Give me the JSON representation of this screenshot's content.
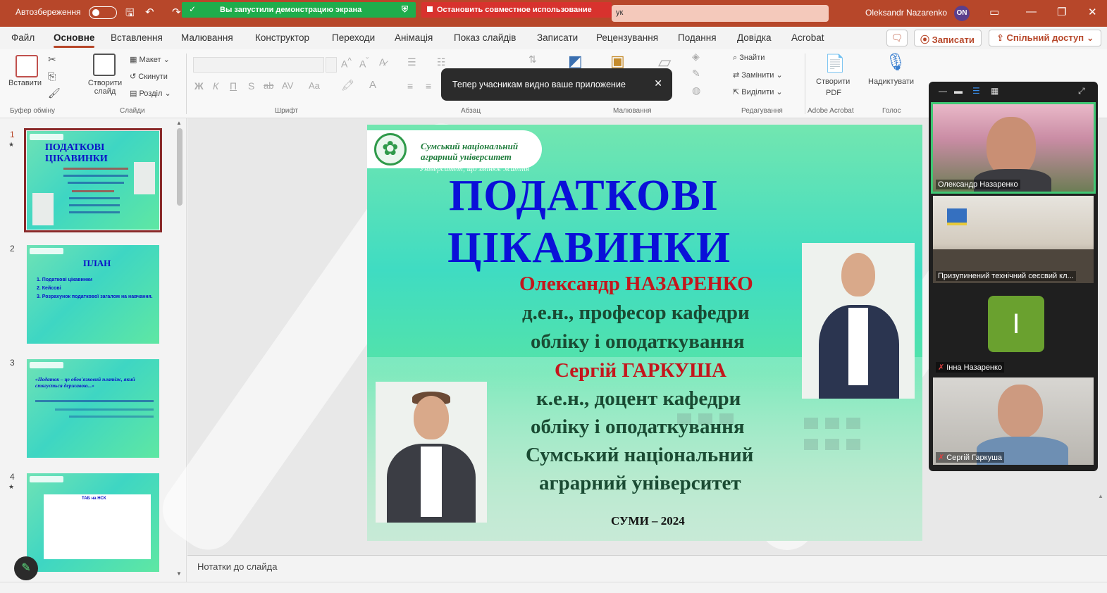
{
  "titlebar": {
    "autosave_label": "Автозбереження",
    "save_icon": "save-icon",
    "undo_icon": "undo-icon",
    "redo_icon": "redo-icon",
    "search_text": "ук",
    "user_name": "Oleksandr Nazarenko",
    "user_initials": "ON"
  },
  "screen_share": {
    "active_text": "Вы запустили демонстрацию экрана",
    "stop_text": "Остановить совместное использование"
  },
  "menu": {
    "tabs": [
      "Файл",
      "Основне",
      "Вставлення",
      "Малювання",
      "Конструктор",
      "Переходи",
      "Анімація",
      "Показ слайдів",
      "Записати",
      "Рецензування",
      "Подання",
      "Довідка",
      "Acrobat"
    ],
    "active_tab": "Основне",
    "record_label": "Записати",
    "share_label": "Спільний доступ"
  },
  "ribbon": {
    "paste": "Вставити",
    "new_slide": "Створити слайд",
    "layout": "Макет",
    "reset": "Скинути",
    "section": "Розділ",
    "find": "Знайти",
    "replace": "Замінити",
    "select": "Виділити",
    "create_pdf_1": "Створити",
    "create_pdf_2": "PDF",
    "dictate": "Надиктувати",
    "groups": {
      "clipboard": "Буфер обміну",
      "slides": "Слайди",
      "font": "Шрифт",
      "paragraph": "Абзац",
      "drawing": "Малювання",
      "editing": "Редагування",
      "adobe": "Adobe Acrobat",
      "voice": "Голос"
    }
  },
  "toast": {
    "text": "Тепер учасникам видно ваше приложение"
  },
  "slides_panel": {
    "numbers": [
      "1",
      "2",
      "3",
      "4"
    ],
    "thumb1_title_1": "ПОДАТКОВІ",
    "thumb1_title_2": "ЦІКАВИНКИ",
    "thumb2_title": "ПЛАН",
    "thumb2_items": [
      "1. Податкові цікавинки",
      "2. Кейсові",
      "3. Розрахунок податкової загалом на навчання."
    ],
    "thumb3_quote": "«Податок – це обов'язковий платіж, який стягується державою...»",
    "thumb4_title": "ТАБ на НСК"
  },
  "slide": {
    "university_1": "Сумський національний",
    "university_2": "аграрний університет",
    "motto": "Університет, що змінює життя",
    "title_1": "ПОДАТКОВІ",
    "title_2": "ЦІКАВИНКИ",
    "author1_name": "Олександр НАЗАРЕНКО",
    "author1_line1": "д.е.н., професор кафедри",
    "author1_line2": "обліку і оподаткування",
    "author2_name": "Сергій ГАРКУША",
    "author2_line1": "к.е.н., доцент кафедри",
    "author2_line2": "обліку і оподаткування",
    "org_line1": "Сумський національний",
    "org_line2": "аграрний університет",
    "city_year": "СУМИ – 2024"
  },
  "notes": {
    "placeholder": "Нотатки до слайда"
  },
  "meeting": {
    "participants": [
      {
        "name": "Олександр Назаренко",
        "muted": false
      },
      {
        "name": "Призупинений технічний сеєсвий кл...",
        "muted": false
      },
      {
        "name": "Інна Назаренко",
        "muted": true,
        "initial": "І"
      },
      {
        "name": "Сергій Гаркуша",
        "muted": true
      }
    ]
  },
  "colors": {
    "accent": "#b7472a",
    "slide_title": "#0a10d8",
    "slide_name": "#c4161c",
    "share_green": "#1fad4c",
    "stop_red": "#d8322e",
    "active_speaker": "#40c774"
  }
}
